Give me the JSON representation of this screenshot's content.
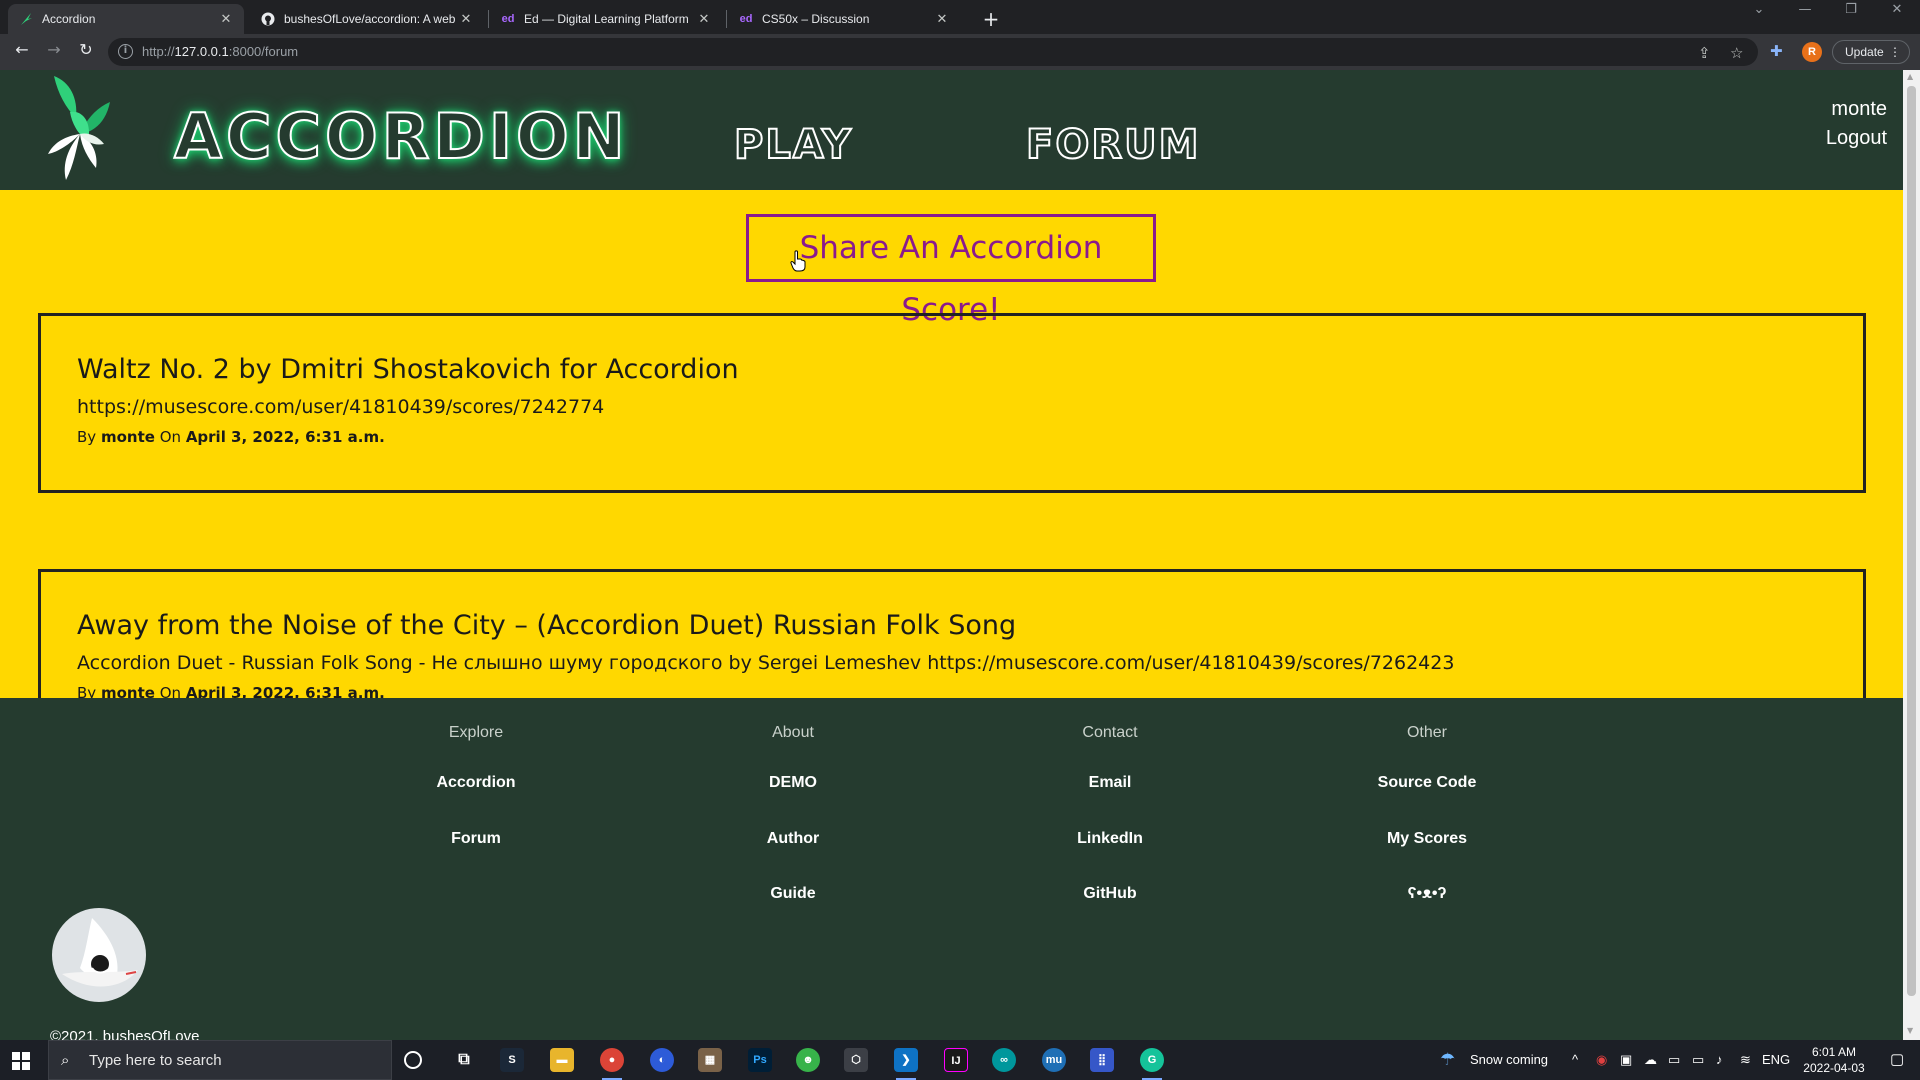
{
  "browser": {
    "tabs": [
      {
        "title": "Accordion",
        "favicon": "accordion-leaf-icon"
      },
      {
        "title": "bushesOfLove/accordion: A web",
        "favicon": "github-icon"
      },
      {
        "title": "Ed — Digital Learning Platform",
        "favicon": "ed-icon",
        "favicon_text": "ed"
      },
      {
        "title": "CS50x – Discussion",
        "favicon": "ed-icon",
        "favicon_text": "ed"
      }
    ],
    "url_prefix": "http://",
    "url_host": "127.0.0.1",
    "url_path": ":8000/forum",
    "update_label": "Update",
    "profile_initial": "R"
  },
  "site": {
    "brand": "ACCORDION",
    "nav": {
      "play": "PLAY",
      "forum": "FORUM"
    },
    "user": {
      "name": "monte",
      "logout": "Logout"
    },
    "share_button": "Share An Accordion Score!",
    "posts": [
      {
        "title": "Waltz No. 2 by Dmitri Shostakovich for Accordion",
        "body": "https://musescore.com/user/41810439/scores/7242774",
        "by_label": "By",
        "author": "monte",
        "on_label": "On",
        "date": "April 3, 2022, 6:31 a.m."
      },
      {
        "title": "Away from the Noise of the City – (Accordion Duet) Russian Folk Song",
        "body": "Accordion Duet - Russian Folk Song - Не слышно шуму городского by Sergei Lemeshev https://musescore.com/user/41810439/scores/7262423",
        "by_label": "By",
        "author": "monte",
        "on_label": "On",
        "date": "April 3, 2022, 6:31 a.m."
      }
    ],
    "footer": {
      "columns": [
        {
          "heading": "Explore",
          "links": [
            "Accordion",
            "Forum"
          ]
        },
        {
          "heading": "About",
          "links": [
            "DEMO",
            "Author",
            "Guide"
          ]
        },
        {
          "heading": "Contact",
          "links": [
            "Email",
            "LinkedIn",
            "GitHub"
          ]
        },
        {
          "heading": "Other",
          "links": [
            "Source Code",
            "My Scores",
            "ʕ•ᴥ•ʔ"
          ]
        }
      ],
      "copyright": "©2021, bushesOfLove"
    }
  },
  "taskbar": {
    "search_placeholder": "Type here to search",
    "weather": "Snow coming",
    "language": "ENG",
    "time": "6:01 AM",
    "date": "2022-04-03"
  },
  "colors": {
    "page_bg": "#ffd800",
    "nav_bg": "#253b2f",
    "accent_purple": "#8a1a8e",
    "brand_glow": "#24d37a"
  }
}
